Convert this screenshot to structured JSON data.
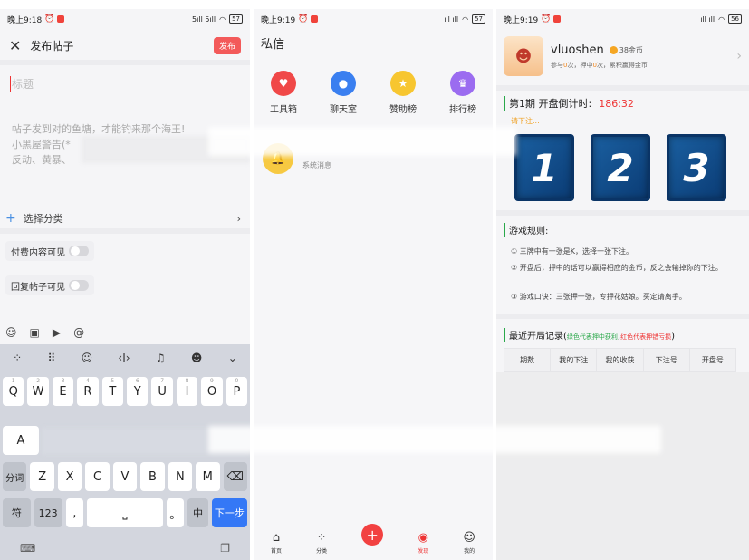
{
  "panel1": {
    "status": {
      "time": "晚上9:18",
      "signal": "5ıll 5ıll",
      "battery": "57"
    },
    "header": {
      "title": "发布帖子",
      "publish": "发布"
    },
    "title_placeholder": "标题",
    "body_text": [
      "帖子发到对的鱼塘，才能钓来那个海王!",
      "小黑屋警告(*",
      "反动、黄暴、"
    ],
    "category": "选择分类",
    "toggles": [
      "付费内容可见",
      "回复帖子可见"
    ],
    "emoji_icons": [
      "smile-icon",
      "image-icon",
      "video-icon",
      "at-icon"
    ],
    "at_symbol": "@",
    "keyboard": {
      "toolbar_icons": [
        "grid-icon",
        "keypad-icon",
        "emoji-icon",
        "cursor-icon",
        "mic-icon",
        "sticker-icon",
        "chevron-down-icon"
      ],
      "row1": [
        [
          "Q",
          "1"
        ],
        [
          "W",
          "2"
        ],
        [
          "E",
          "3"
        ],
        [
          "R",
          "4"
        ],
        [
          "T",
          "5"
        ],
        [
          "Y",
          "6"
        ],
        [
          "U",
          "7"
        ],
        [
          "I",
          "8"
        ],
        [
          "O",
          "9"
        ],
        [
          "P",
          "0"
        ]
      ],
      "row2_first": "A",
      "row3": [
        "分词",
        "Z",
        "X",
        "C",
        "V",
        "B",
        "N",
        "M"
      ],
      "row4": {
        "sym": "符",
        "num": "123",
        "comma": ",",
        "period": "。",
        "zh": "中",
        "next": "下一步"
      }
    }
  },
  "panel2": {
    "status": {
      "time": "晚上9:19",
      "battery": "57"
    },
    "title": "私信",
    "grid": [
      {
        "label": "工具箱",
        "color": "#f04848"
      },
      {
        "label": "聊天室",
        "color": "#3a7ff0"
      },
      {
        "label": "赞助榜",
        "color": "#f7c630"
      },
      {
        "label": "排行榜",
        "color": "#9b6cf0"
      }
    ],
    "system_msg": "系统消息",
    "tabs": [
      {
        "label": "首页",
        "icon": "home-icon"
      },
      {
        "label": "分类",
        "icon": "category-icon"
      },
      {
        "label": "发现",
        "icon": "discover-icon"
      },
      {
        "label": "我的",
        "icon": "profile-icon"
      }
    ],
    "fab": "+"
  },
  "panel3": {
    "status": {
      "time": "晚上9:19",
      "battery": "56"
    },
    "user": {
      "name": "vluoshen",
      "coins": "38金币",
      "stats_prefix": "参与",
      "participate": "0",
      "stats_mid": "次，押中",
      "hit": "0",
      "stats_suffix": "次，累积赢得金币"
    },
    "period_label": "第1期 开盘倒计时:",
    "countdown": "186:32",
    "bet_hint": "请下注...",
    "cards": [
      "1",
      "2",
      "3"
    ],
    "rules_title": "游戏规则:",
    "rules": [
      "① 三牌中有一张是K，选择一张下注。",
      "② 开盘后，押中的话可以赢得相应的金币，反之会输掉你的下注。",
      "③ 游戏口诀：三张押一张，专押花姑娘。买定请离手。"
    ],
    "records_title": "最近开局记录",
    "records_note_open": "(",
    "records_note_green": "绿色代表押中获利",
    "records_note_comma": ",",
    "records_note_red": "红色代表押错亏损",
    "records_note_close": ")",
    "table_headers": [
      "期数",
      "我的下注",
      "我的收获",
      "下注号",
      "开盘号"
    ]
  }
}
